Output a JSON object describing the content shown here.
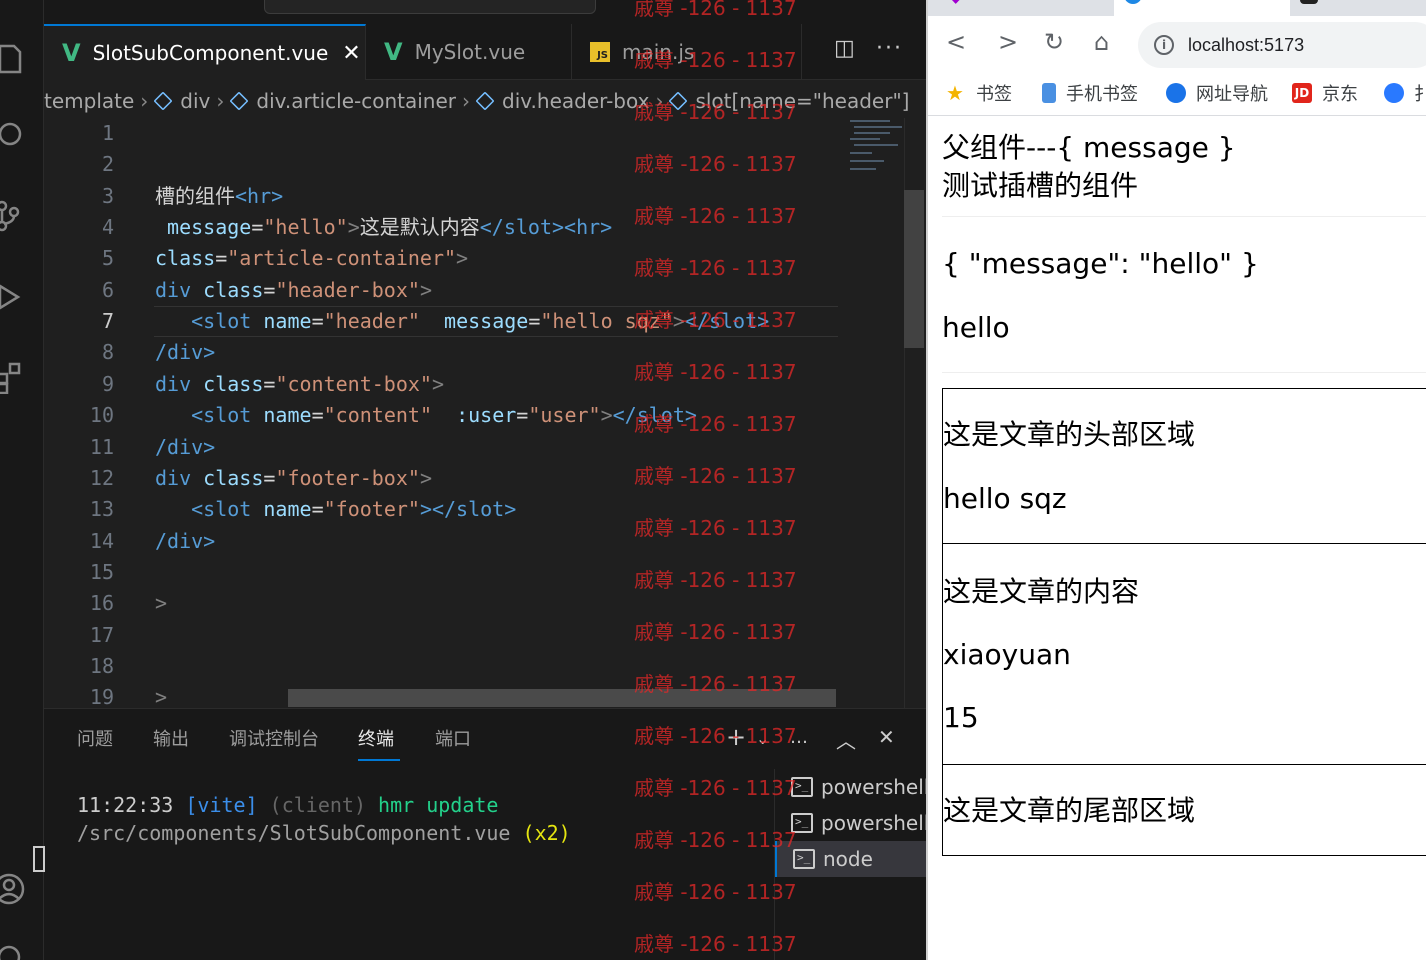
{
  "vscode": {
    "tabs": [
      {
        "label": "SlotSubComponent.vue",
        "icon": "vue-icon",
        "active": true
      },
      {
        "label": "MySlot.vue",
        "icon": "vue-icon",
        "active": false
      },
      {
        "label": "main.js",
        "icon": "js-icon",
        "active": false
      }
    ],
    "breadcrumb": [
      "template",
      "div",
      "div.article-container",
      "div.header-box",
      "slot[name=\"header\"]"
    ],
    "line_numbers": [
      "1",
      "2",
      "3",
      "4",
      "5",
      "6",
      "7",
      "8",
      "9",
      "10",
      "11",
      "12",
      "13",
      "14",
      "15",
      "16",
      "17",
      "18",
      "19"
    ],
    "current_line": "7",
    "code": {
      "l3_text": "槽的组件",
      "l3_tag": "<hr>",
      "l4_attr": "message",
      "l4_str": "\"hello\"",
      "l4_text": "这是默认内容",
      "l4_close": "</slot><hr>",
      "l5_attr": "class",
      "l5_str": "\"article-container\"",
      "l6_tag": "div",
      "l6_attr": "class",
      "l6_str": "\"header-box\"",
      "l7_tag": "<slot",
      "l7_attr1": "name",
      "l7_str1": "\"header\"",
      "l7_attr2": "message",
      "l7_str2": "\"hello sqz\"",
      "l7_close": "</slot>",
      "l8": "/div>",
      "l9_tag": "div",
      "l9_attr": "class",
      "l9_str": "\"content-box\"",
      "l10_tag": "<slot",
      "l10_attr1": "name",
      "l10_str1": "\"content\"",
      "l10_attr2": ":user",
      "l10_str2": "\"user\"",
      "l10_close": "</slot>",
      "l11": "/div>",
      "l12_tag": "div",
      "l12_attr": "class",
      "l12_str": "\"footer-box\"",
      "l13_tag": "<slot",
      "l13_attr": "name",
      "l13_str": "\"footer\"",
      "l13_close": "></slot>",
      "l14": "/div>",
      "l16": ">",
      "l19": ">"
    },
    "panel_tabs": [
      "问题",
      "输出",
      "调试控制台",
      "终端",
      "端口"
    ],
    "active_panel_tab": "终端",
    "terminal": {
      "time": "11:22:33",
      "vite": "[vite]",
      "client": "(client)",
      "msg": "hmr update",
      "path": "/src/components/SlotSubComponent.vue",
      "count": "(x2)"
    },
    "terminal_list": [
      "powershell",
      "powershell",
      "node"
    ],
    "selected_terminal": "node",
    "watermark": "戚尊 -126 - 1137"
  },
  "browser": {
    "url": "localhost:5173",
    "bookmarks": [
      "书签",
      "手机书签",
      "网址导航",
      "京东",
      "扌"
    ],
    "page": {
      "line1": "父组件---{ message }",
      "line2": "测试插槽的组件",
      "json": "{ \"message\": \"hello\" }",
      "hello": "hello",
      "header_title": "这是文章的头部区域",
      "header_msg": "hello sqz",
      "content_title": "这是文章的内容",
      "user_name": "xiaoyuan",
      "user_age": "15",
      "footer_title": "这是文章的尾部区域"
    }
  },
  "colors": {
    "editor_bg": "#1f1f1f",
    "accent": "#0078d4",
    "vue_green": "#41b883",
    "watermark_red": "#e62828"
  }
}
